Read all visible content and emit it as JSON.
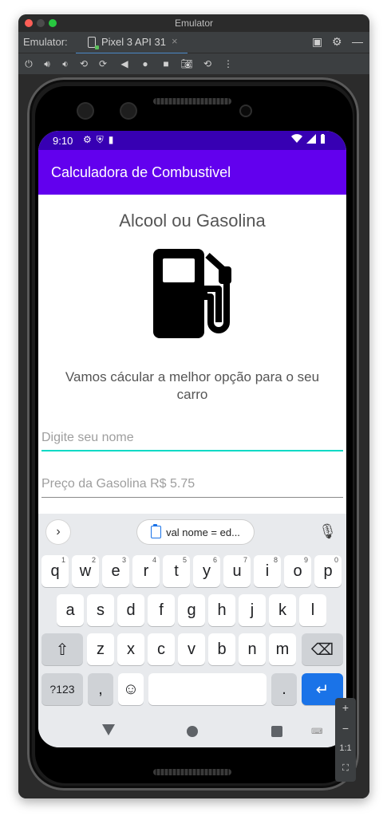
{
  "window": {
    "title": "Emulator"
  },
  "tabbar": {
    "label": "Emulator:",
    "device_tab": "Pixel 3 API 31",
    "close": "×"
  },
  "status": {
    "time": "9:10"
  },
  "app": {
    "title": "Calculadora de Combustivel",
    "headline": "Alcool ou Gasolina",
    "subtitle": "Vamos cácular a melhor opção para o seu carro",
    "name_placeholder": "Digite seu nome",
    "gas_placeholder": "Preço da Gasolina R$ 5.75"
  },
  "keyboard": {
    "suggestion": "val nome = ed...",
    "row1": [
      {
        "k": "q",
        "s": "1"
      },
      {
        "k": "w",
        "s": "2"
      },
      {
        "k": "e",
        "s": "3"
      },
      {
        "k": "r",
        "s": "4"
      },
      {
        "k": "t",
        "s": "5"
      },
      {
        "k": "y",
        "s": "6"
      },
      {
        "k": "u",
        "s": "7"
      },
      {
        "k": "i",
        "s": "8"
      },
      {
        "k": "o",
        "s": "9"
      },
      {
        "k": "p",
        "s": "0"
      }
    ],
    "row2": [
      "a",
      "s",
      "d",
      "f",
      "g",
      "h",
      "j",
      "k",
      "l"
    ],
    "row3": [
      "z",
      "x",
      "c",
      "v",
      "b",
      "n",
      "m"
    ],
    "symbols": "?123",
    "comma": ",",
    "period": "."
  },
  "side_panel": {
    "zoom_in": "+",
    "zoom_out": "−",
    "ratio": "1:1"
  },
  "colors": {
    "statusbar": "#3700b3",
    "appbar": "#6200ee",
    "focus_line": "#03dac5",
    "enter_key": "#1a73e8"
  }
}
